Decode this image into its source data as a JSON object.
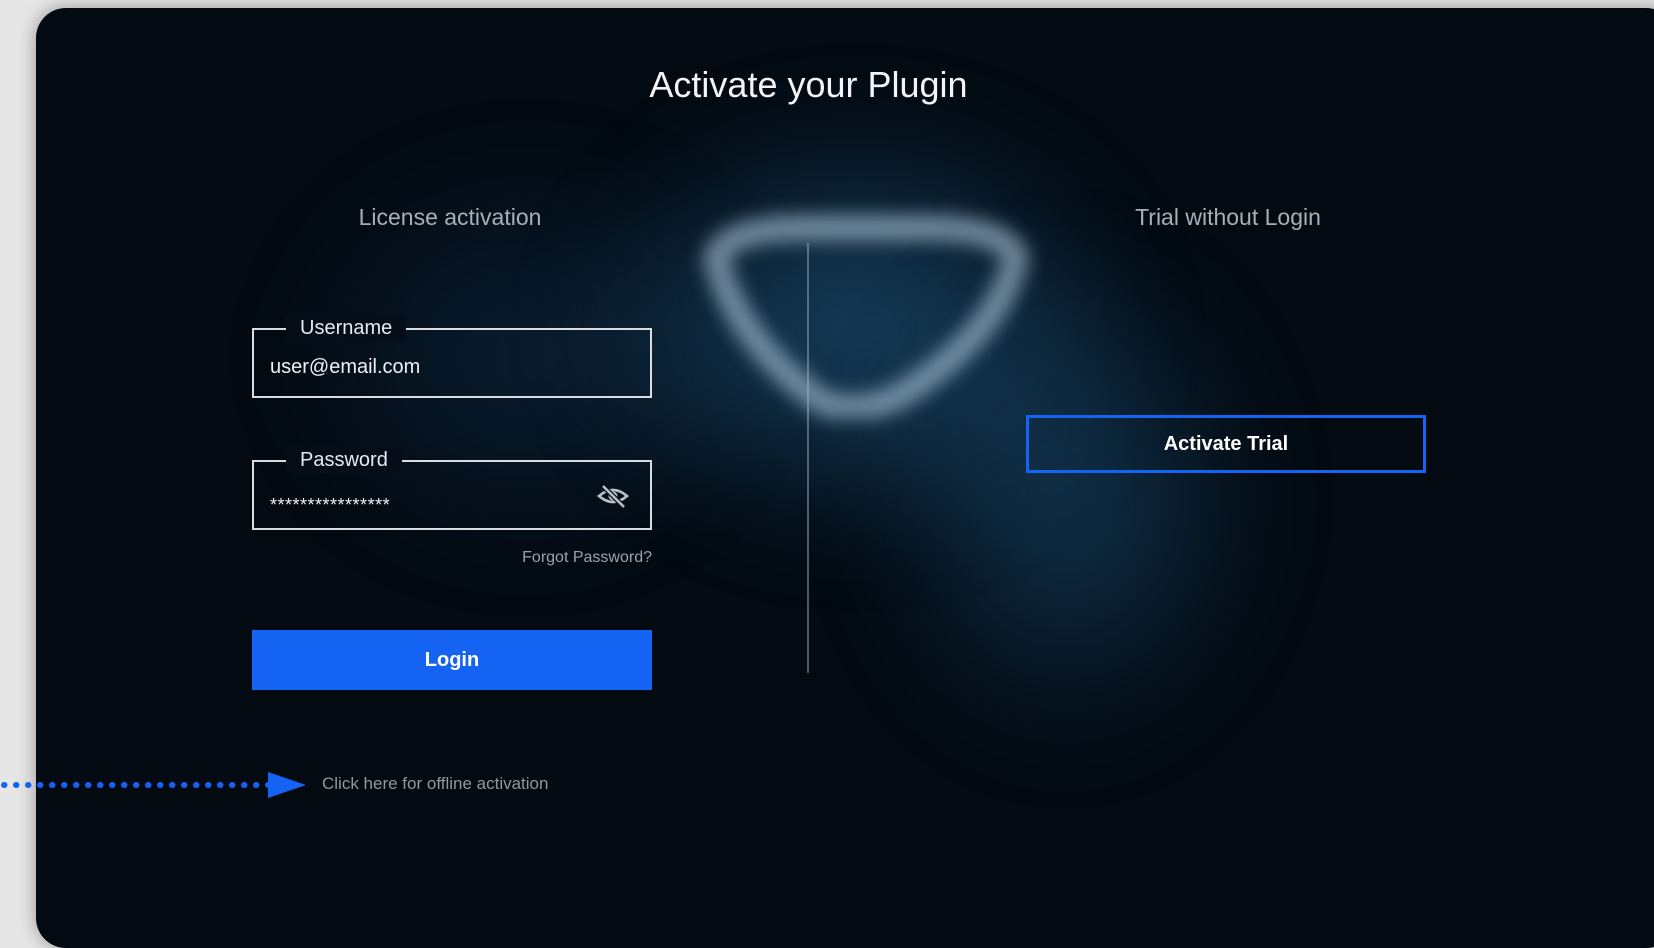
{
  "dialog": {
    "title": "Activate your Plugin"
  },
  "license": {
    "heading": "License activation",
    "username_label": "Username",
    "username_value": "user@email.com",
    "password_label": "Password",
    "password_value": "****************",
    "password_toggle_icon": "eye-slash-icon",
    "forgot_password": "Forgot Password?",
    "login_label": "Login",
    "offline_link": "Click here for offline activation"
  },
  "trial": {
    "heading": "Trial without Login",
    "activate_label": "Activate Trial"
  },
  "colors": {
    "accent": "#1463f3",
    "background": "#030a12",
    "callout_arrow": "#1463f3"
  }
}
